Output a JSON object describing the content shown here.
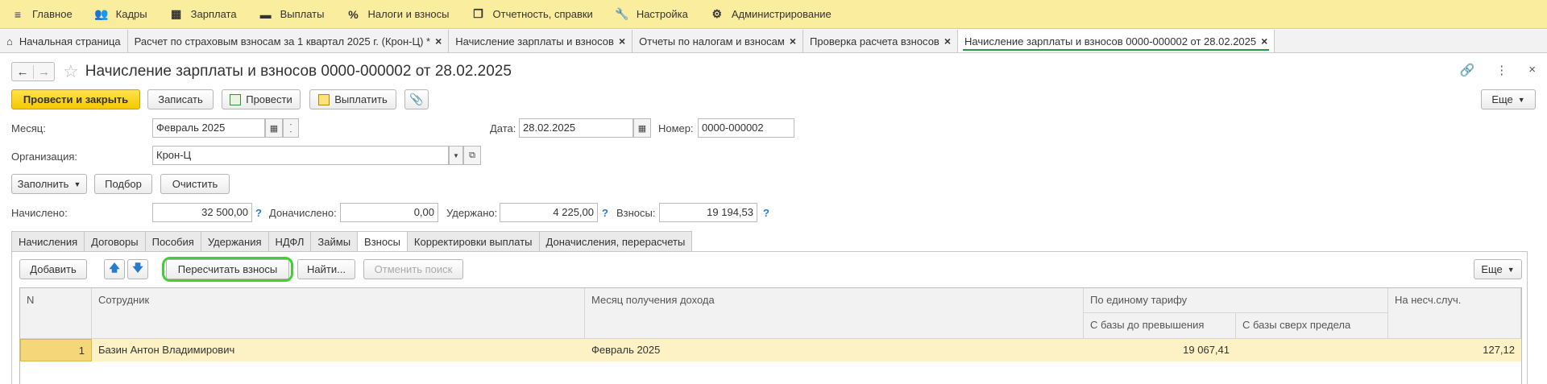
{
  "menu": [
    {
      "label": "Главное",
      "icon": "hamburger-icon"
    },
    {
      "label": "Кадры",
      "icon": "people-icon"
    },
    {
      "label": "Зарплата",
      "icon": "calculator-icon"
    },
    {
      "label": "Выплаты",
      "icon": "wallet-icon"
    },
    {
      "label": "Налоги и взносы",
      "icon": "percent-icon"
    },
    {
      "label": "Отчетность, справки",
      "icon": "report-icon"
    },
    {
      "label": "Настройка",
      "icon": "wrench-icon"
    },
    {
      "label": "Администрирование",
      "icon": "gear-icon"
    }
  ],
  "open_tabs": [
    {
      "label": "Начальная страница"
    },
    {
      "label": "Расчет по страховым взносам за 1 квартал 2025 г. (Крон-Ц) *"
    },
    {
      "label": "Начисление зарплаты и взносов"
    },
    {
      "label": "Отчеты по налогам и взносам"
    },
    {
      "label": "Проверка расчета взносов"
    },
    {
      "label": "Начисление зарплаты и взносов 0000-000002 от 28.02.2025"
    }
  ],
  "doc": {
    "title": "Начисление зарплаты и взносов 0000-000002 от 28.02.2025"
  },
  "toolbar": {
    "post_close": "Провести и закрыть",
    "save": "Записать",
    "post": "Провести",
    "pay": "Выплатить",
    "more": "Еще"
  },
  "form": {
    "month_label": "Месяц:",
    "month_value": "Февраль 2025",
    "date_label": "Дата:",
    "date_value": "28.02.2025",
    "number_label": "Номер:",
    "number_value": "0000-000002",
    "org_label": "Организация:",
    "org_value": "Крон-Ц",
    "fill": "Заполнить",
    "select": "Подбор",
    "clear": "Очистить",
    "accrued_label": "Начислено:",
    "accrued_value": "32 500,00",
    "additional_label": "Доначислено:",
    "additional_value": "0,00",
    "withheld_label": "Удержано:",
    "withheld_value": "4 225,00",
    "contrib_label": "Взносы:",
    "contrib_value": "19 194,53",
    "help": "?"
  },
  "form_tabs": [
    "Начисления",
    "Договоры",
    "Пособия",
    "Удержания",
    "НДФЛ",
    "Займы",
    "Взносы",
    "Корректировки выплаты",
    "Доначисления, перерасчеты"
  ],
  "panel_toolbar": {
    "add": "Добавить",
    "recalc": "Пересчитать взносы",
    "find": "Найти...",
    "cancel_search": "Отменить поиск",
    "more": "Еще"
  },
  "table": {
    "headers": {
      "n": "N",
      "employee": "Сотрудник",
      "month": "Месяц получения дохода",
      "unified": "По единому тарифу",
      "base_below": "С базы до превышения",
      "base_above": "С базы сверх предела",
      "accident": "На несч.случ."
    },
    "rows": [
      {
        "n": "1",
        "employee": "Базин Антон Владимирович",
        "month": "Февраль 2025",
        "base_below": "19 067,41",
        "base_above": "",
        "accident": "127,12"
      }
    ]
  },
  "colors": {
    "menubar": "#fbed9e",
    "accent_yellow": "#f5c800",
    "highlight": "#3ed12f",
    "selected_row": "#fcf2c5"
  }
}
